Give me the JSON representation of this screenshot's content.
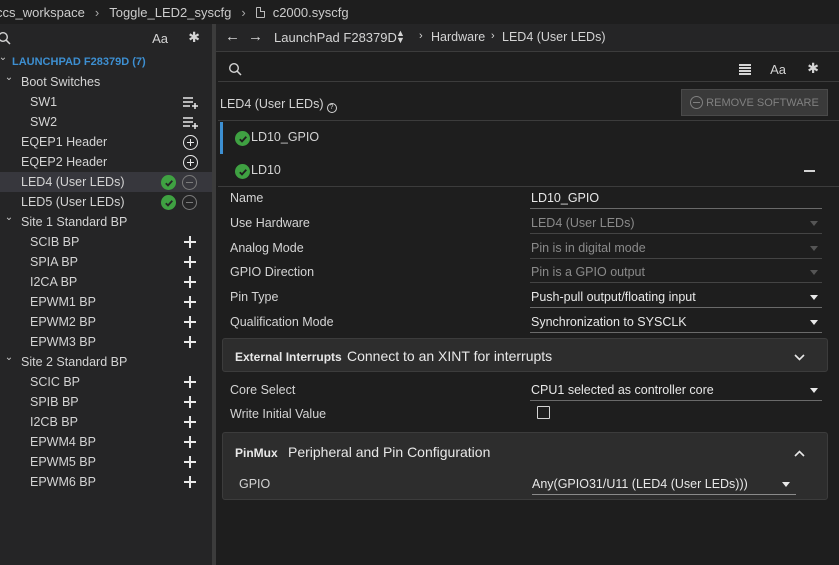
{
  "breadcrumb": {
    "items": [
      "ccs_workspace",
      "Toggle_LED2_syscfg",
      "c2000.syscfg"
    ]
  },
  "left_panel": {
    "search_icon": "search-icon",
    "match_case": "Aa",
    "filter_icon": "wand-icon",
    "tree": [
      {
        "label": "LAUNCHPAD F28379D (7)",
        "level": 0,
        "kind": "root",
        "action": "none"
      },
      {
        "label": "Boot Switches",
        "level": 1,
        "kind": "group",
        "action": "none"
      },
      {
        "label": "SW1",
        "level": 2,
        "kind": "item",
        "action": "list-add"
      },
      {
        "label": "SW2",
        "level": 2,
        "kind": "item",
        "action": "list-add"
      },
      {
        "label": "EQEP1 Header",
        "level": 1,
        "kind": "item",
        "action": "add-circle"
      },
      {
        "label": "EQEP2 Header",
        "level": 1,
        "kind": "item",
        "action": "add-circle"
      },
      {
        "label": "LED4 (User LEDs)",
        "level": 1,
        "kind": "item",
        "action": "added",
        "selected": true
      },
      {
        "label": "LED5 (User LEDs)",
        "level": 1,
        "kind": "item",
        "action": "added"
      },
      {
        "label": "Site 1 Standard BP",
        "level": 1,
        "kind": "group",
        "action": "none"
      },
      {
        "label": "SCIB BP",
        "level": 2,
        "kind": "item",
        "action": "add"
      },
      {
        "label": "SPIA BP",
        "level": 2,
        "kind": "item",
        "action": "add"
      },
      {
        "label": "I2CA BP",
        "level": 2,
        "kind": "item",
        "action": "add"
      },
      {
        "label": "EPWM1 BP",
        "level": 2,
        "kind": "item",
        "action": "add"
      },
      {
        "label": "EPWM2 BP",
        "level": 2,
        "kind": "item",
        "action": "add"
      },
      {
        "label": "EPWM3 BP",
        "level": 2,
        "kind": "item",
        "action": "add"
      },
      {
        "label": "Site 2 Standard BP",
        "level": 1,
        "kind": "group",
        "action": "none"
      },
      {
        "label": "SCIC BP",
        "level": 2,
        "kind": "item",
        "action": "add"
      },
      {
        "label": "SPIB BP",
        "level": 2,
        "kind": "item",
        "action": "add"
      },
      {
        "label": "I2CB BP",
        "level": 2,
        "kind": "item",
        "action": "add"
      },
      {
        "label": "EPWM4 BP",
        "level": 2,
        "kind": "item",
        "action": "add"
      },
      {
        "label": "EPWM5 BP",
        "level": 2,
        "kind": "item",
        "action": "add"
      },
      {
        "label": "EPWM6 BP",
        "level": 2,
        "kind": "item",
        "action": "add"
      }
    ]
  },
  "nav": {
    "device": "LaunchPad F28379D",
    "crumbs": [
      "Hardware",
      "LED4 (User LEDs)"
    ]
  },
  "right_search": {
    "match_case": "Aa"
  },
  "section": {
    "title": "LED4 (User LEDs)",
    "help": "?",
    "remove_label": "REMOVE SOFTWARE"
  },
  "instance": {
    "name": "LD10_GPIO",
    "sub_name": "LD10"
  },
  "properties": [
    {
      "label": "Name",
      "value": "LD10_GPIO",
      "kind": "text"
    },
    {
      "label": "Use Hardware",
      "value": "LED4 (User LEDs)",
      "kind": "select-disabled"
    },
    {
      "label": "Analog Mode",
      "value": "Pin is in digital mode",
      "kind": "select-disabled"
    },
    {
      "label": "GPIO Direction",
      "value": "Pin is a GPIO output",
      "kind": "select-disabled"
    },
    {
      "label": "Pin Type",
      "value": "Push-pull output/floating input",
      "kind": "select"
    },
    {
      "label": "Qualification Mode",
      "value": "Synchronization to SYSCLK",
      "kind": "select"
    }
  ],
  "ext_interrupts": {
    "key": "External Interrupts",
    "desc": "Connect to an XINT for interrupts"
  },
  "properties2": [
    {
      "label": "Core Select",
      "value": "CPU1 selected as controller core",
      "kind": "select"
    },
    {
      "label": "Write Initial Value",
      "value": "",
      "kind": "checkbox"
    }
  ],
  "pinmux": {
    "key": "PinMux",
    "desc": "Peripheral and Pin Configuration",
    "gpio_label": "GPIO",
    "gpio_value": "Any(GPIO31/U11 (LED4 (User LEDs)))"
  },
  "colors": {
    "accent": "#3d8fd1",
    "check": "#3fa142",
    "background": "#1e1e1e",
    "panel": "#252526"
  }
}
